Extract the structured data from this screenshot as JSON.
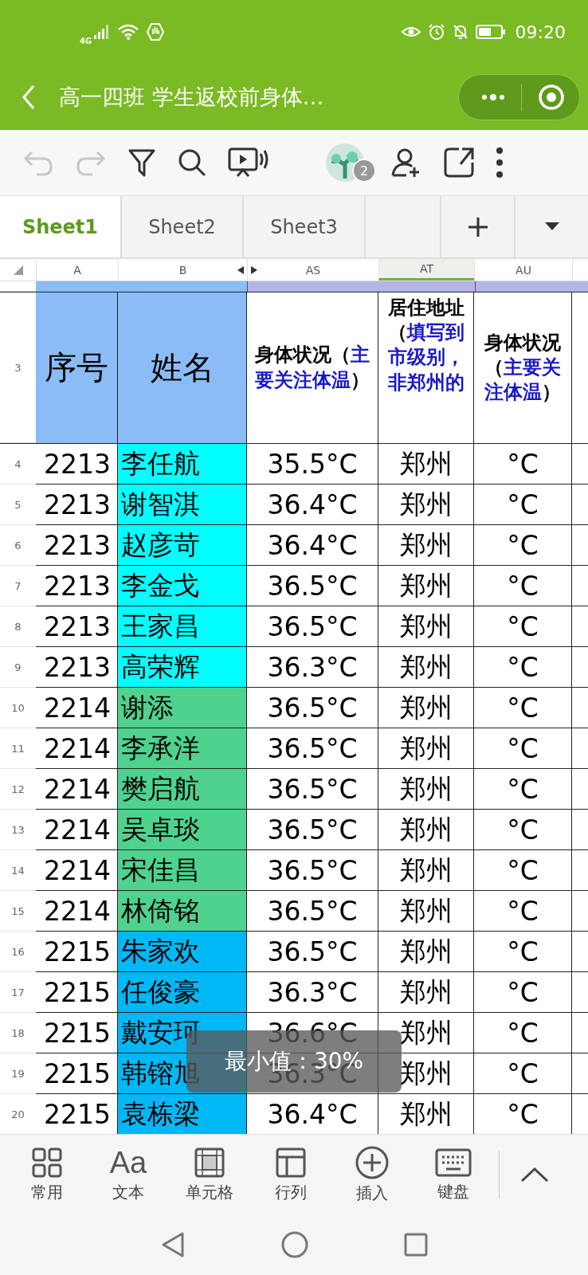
{
  "status_bar": {
    "network": "4G",
    "time": "09:20"
  },
  "title_bar": {
    "title": "高一四班 学生返校前身体…"
  },
  "toolbar": {
    "undo_disabled": true,
    "redo_disabled": true,
    "collaborators": "2"
  },
  "sheet_tabs": [
    {
      "label": "Sheet1",
      "selected": true
    },
    {
      "label": "Sheet2",
      "selected": false
    },
    {
      "label": "Sheet3",
      "selected": false
    }
  ],
  "columns": [
    {
      "label": "A",
      "selected": false
    },
    {
      "label": "B",
      "selected": false
    },
    {
      "label": "AS",
      "selected": false
    },
    {
      "label": "AT",
      "selected": true
    },
    {
      "label": "AU",
      "selected": false
    }
  ],
  "header_row": {
    "number": "3",
    "cells": [
      [
        {
          "text": "序号",
          "highlight": false
        }
      ],
      [
        {
          "text": "姓名",
          "highlight": false
        }
      ],
      [
        {
          "text": "身体状况（",
          "highlight": false
        },
        {
          "text": "主要关注体温",
          "highlight": true
        },
        {
          "text": "）",
          "highlight": false
        }
      ],
      [
        {
          "text": "居住地址（",
          "highlight": false
        },
        {
          "text": "填写到市级别，非郑州的",
          "highlight": true
        }
      ],
      [
        {
          "text": "身体状况（",
          "highlight": false
        },
        {
          "text": "主要关注体温",
          "highlight": true
        },
        {
          "text": "）",
          "highlight": false
        }
      ]
    ]
  },
  "rows": [
    {
      "number": "4",
      "id": "2213",
      "name": "李任航",
      "color": "#00ffff",
      "temp": "35.5°C",
      "city": "郑州",
      "au": "°C"
    },
    {
      "number": "5",
      "id": "2213",
      "name": "谢智淇",
      "color": "#00ffff",
      "temp": "36.4°C",
      "city": "郑州",
      "au": "°C"
    },
    {
      "number": "6",
      "id": "2213",
      "name": "赵彦苛",
      "color": "#00ffff",
      "temp": "36.4°C",
      "city": "郑州",
      "au": "°C"
    },
    {
      "number": "7",
      "id": "2213",
      "name": "李金戈",
      "color": "#00ffff",
      "temp": "36.5°C",
      "city": "郑州",
      "au": "°C"
    },
    {
      "number": "8",
      "id": "2213",
      "name": "王家昌",
      "color": "#00ffff",
      "temp": "36.5°C",
      "city": "郑州",
      "au": "°C"
    },
    {
      "number": "9",
      "id": "2213",
      "name": "高荣辉",
      "color": "#00ffff",
      "temp": "36.3°C",
      "city": "郑州",
      "au": "°C"
    },
    {
      "number": "10",
      "id": "2214",
      "name": "谢添",
      "color": "#4ed28e",
      "temp": "36.5°C",
      "city": "郑州",
      "au": "°C"
    },
    {
      "number": "11",
      "id": "2214",
      "name": "李承洋",
      "color": "#4ed28e",
      "temp": "36.5°C",
      "city": "郑州",
      "au": "°C"
    },
    {
      "number": "12",
      "id": "2214",
      "name": "樊启航",
      "color": "#4ed28e",
      "temp": "36.5°C",
      "city": "郑州",
      "au": "°C"
    },
    {
      "number": "13",
      "id": "2214",
      "name": "吴卓琰",
      "color": "#4ed28e",
      "temp": "36.5°C",
      "city": "郑州",
      "au": "°C"
    },
    {
      "number": "14",
      "id": "2214",
      "name": "宋佳昌",
      "color": "#4ed28e",
      "temp": "36.5°C",
      "city": "郑州",
      "au": "°C"
    },
    {
      "number": "15",
      "id": "2214",
      "name": "林倚铭",
      "color": "#4ed28e",
      "temp": "36.5°C",
      "city": "郑州",
      "au": "°C"
    },
    {
      "number": "16",
      "id": "2215",
      "name": "朱家欢",
      "color": "#00b8f5",
      "temp": "36.5°C",
      "city": "郑州",
      "au": "°C"
    },
    {
      "number": "17",
      "id": "2215",
      "name": "任俊豪",
      "color": "#00b8f5",
      "temp": "36.3°C",
      "city": "郑州",
      "au": "°C"
    },
    {
      "number": "18",
      "id": "2215",
      "name": "戴安珂",
      "color": "#00b8f5",
      "temp": "36.6°C",
      "city": "郑州",
      "au": "°C"
    },
    {
      "number": "19",
      "id": "2215",
      "name": "韩镕旭",
      "color": "#00b8f5",
      "temp": "36.3°C",
      "city": "郑州",
      "au": "°C"
    },
    {
      "number": "20",
      "id": "2215",
      "name": "袁栋梁",
      "color": "#00b8f5",
      "temp": "36.4°C",
      "city": "郑州",
      "au": "°C"
    }
  ],
  "tooltip": {
    "text": "最小值：30%"
  },
  "bottom_toolbar": [
    {
      "kind": "grid",
      "label": "常用"
    },
    {
      "kind": "glyph",
      "glyph": "Aa",
      "label": "文本"
    },
    {
      "kind": "cell",
      "label": "单元格"
    },
    {
      "kind": "table",
      "label": "行列"
    },
    {
      "kind": "plus",
      "label": "插入"
    },
    {
      "kind": "keyboard",
      "label": "键盘"
    }
  ]
}
